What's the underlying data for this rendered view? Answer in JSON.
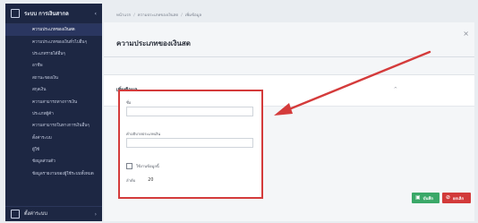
{
  "sidebar": {
    "app_title": "ระบบ การเงินสากล",
    "items": [
      {
        "label": "ความประเภทของเงินสด"
      },
      {
        "label": "ความประเภทของเงินทั่วไปอื่นๆ"
      },
      {
        "label": "ประเภทรายได้อื่นๆ"
      },
      {
        "label": "อาชีพ"
      },
      {
        "label": "สถานะของเงิน"
      },
      {
        "label": "สกุลเงิน"
      },
      {
        "label": "ความสามารถทางการเงิน"
      },
      {
        "label": "ประเภทผู้ค้า"
      },
      {
        "label": "ความสามารถในทางการเงินอื่นๆ"
      },
      {
        "label": "ตั้งค่าระบบ"
      },
      {
        "label": "ผู้ใช้"
      },
      {
        "label": "ข้อมูลส่วนตัว"
      },
      {
        "label": "ข้อมูลรายงานของผู้ใช้ระบบทั้งหมด"
      }
    ],
    "footer_label": "ตั้งค่าระบบ"
  },
  "breadcrumb": [
    "หน้าแรก",
    "ความประเภทของเงินสด",
    "เพิ่มข้อมูล"
  ],
  "panel": {
    "title": "ความประเภทของเงินสด",
    "close": "×",
    "section_title": "เพิ่มข้อมูล",
    "section_caret": "^"
  },
  "form": {
    "name_label": "ชื่อ",
    "name_value": "",
    "desc_label": "คำอธิบายประเภทเงิน",
    "desc_value": "",
    "check_label": "ใช้งานข้อมูลนี้",
    "order_label": "ลำดับ",
    "order_value": "20"
  },
  "buttons": {
    "save": "บันทึก",
    "cancel": "ยกเลิก"
  },
  "colors": {
    "sidebar_bg": "#1d2743",
    "highlight": "#d43b3b",
    "save": "#3aa868",
    "cancel": "#d23a3a"
  }
}
